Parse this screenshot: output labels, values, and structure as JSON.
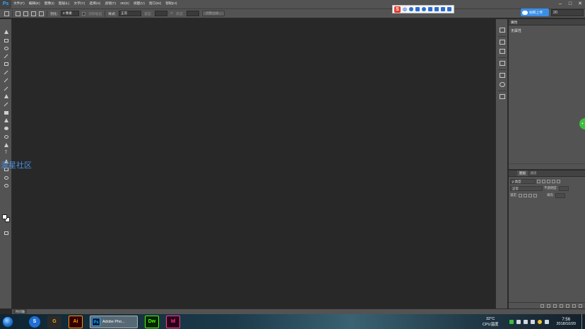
{
  "app": {
    "logo": "Ps"
  },
  "menu": [
    "文件(F)",
    "编辑(E)",
    "图像(I)",
    "图层(L)",
    "文字(Y)",
    "选择(S)",
    "滤镜(T)",
    "3D(D)",
    "视图(V)",
    "窗口(W)",
    "帮助(H)"
  ],
  "window_controls": {
    "minimize": "–",
    "restore": "□",
    "close": "✕"
  },
  "options_bar": {
    "feather_label": "羽化:",
    "feather_value": "0 像素",
    "antialias_label": "消除锯齿",
    "style_label": "样式:",
    "style_value": "正常",
    "width_label": "宽度:",
    "height_label": "高度:",
    "refine_edge_label": "调整边缘..."
  },
  "cloud": {
    "label": "拍照上传"
  },
  "workspace": {
    "value": "20"
  },
  "ime": {
    "brand": "S",
    "mode": "中"
  },
  "watermark": "混星社区",
  "properties_panel": {
    "tab": "属性",
    "empty_text": "无属性"
  },
  "layers_panel": {
    "tabs": [
      "图层",
      "通道"
    ],
    "filter_label": "ρ 类型",
    "blend_mode": "正常",
    "opacity_label": "不透明度:",
    "lock_label": "锁定:",
    "fill_label": "填充:"
  },
  "timeline": {
    "tab": "时间轴"
  },
  "float_button": "+",
  "taskbar": {
    "apps": [
      {
        "name": "sogou",
        "glyph": "S",
        "bg": "#1f6fd6",
        "fg": "#ffffff"
      },
      {
        "name": "g-app",
        "glyph": "G",
        "bg": "#2a2a2a",
        "fg": "#f0a81c"
      },
      {
        "name": "illustrator",
        "glyph": "Ai",
        "bg": "#330000",
        "fg": "#ff9a00"
      }
    ],
    "active_window": {
      "icon": "Ps",
      "label": "Adobe Pho..."
    },
    "apps_after": [
      {
        "name": "dreamweaver",
        "glyph": "Dw",
        "bg": "#072401",
        "fg": "#4cff00"
      },
      {
        "name": "indesign",
        "glyph": "Id",
        "bg": "#2b0016",
        "fg": "#ff3da6"
      }
    ],
    "cpu_temp": "32°C",
    "cpu_label": "CPU温度",
    "clock_time": "7:56",
    "clock_date": "2018/10/20"
  }
}
